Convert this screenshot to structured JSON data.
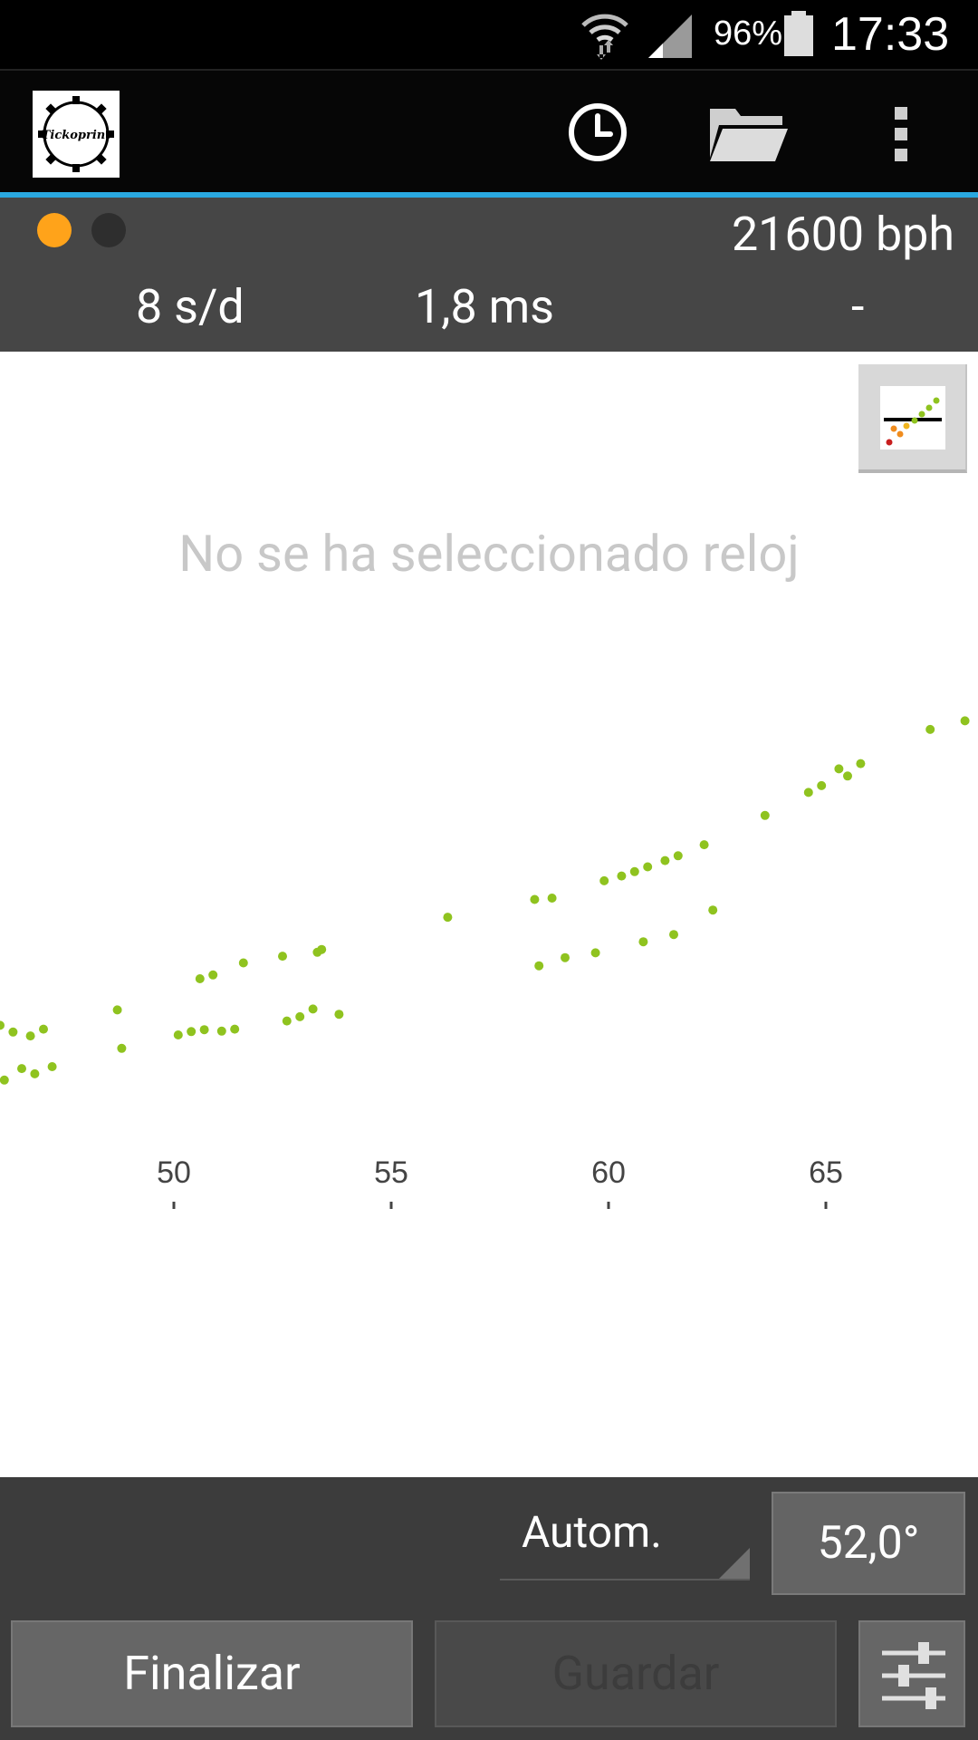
{
  "status_bar": {
    "battery_pct": "96%",
    "time": "17:33",
    "icons": [
      "wifi-icon",
      "signal-icon",
      "battery-icon"
    ]
  },
  "action_bar": {
    "logo_text": "Tickoprint",
    "icons": [
      "clock-icon",
      "folder-icon",
      "overflow-menu-icon"
    ],
    "accent_color": "#2aa8e0"
  },
  "info": {
    "indicator_colors": [
      "#ffa31a",
      "#2e2e2e"
    ],
    "beat_rate": "21600 bph",
    "rate": "8 s/d",
    "amplitude": "1,8 ms",
    "beat_error": "-"
  },
  "chart": {
    "message": "No se ha seleccionado reloj",
    "mode_button_icon": "scatter-chart-icon"
  },
  "chart_data": {
    "type": "scatter",
    "xlabel": "",
    "ylabel": "",
    "x_ticks": [
      "50",
      "55",
      "60",
      "65"
    ],
    "xlim": [
      46.0,
      68.5
    ],
    "ylim": [
      0,
      100
    ],
    "grid": false,
    "point_color": "#8fc31f",
    "series": [
      {
        "x": [
          46.0,
          46.3,
          46.7,
          47.0,
          46.1,
          46.5,
          46.8,
          47.2,
          48.7,
          48.8,
          50.1,
          50.4,
          50.7,
          51.1,
          51.4,
          50.6,
          50.9,
          51.6,
          52.6,
          52.9,
          53.2,
          52.5,
          53.3,
          53.4,
          53.8,
          56.3,
          58.3,
          58.7,
          58.4,
          59.0,
          59.7,
          59.9,
          60.3,
          60.6,
          60.9,
          61.3,
          61.6,
          62.2,
          60.8,
          61.5,
          62.4,
          63.6,
          64.6,
          64.9,
          65.3,
          65.5,
          65.8,
          67.4,
          68.2
        ],
        "y": [
          22.0,
          20.6,
          19.8,
          21.2,
          10.6,
          13.0,
          11.9,
          13.4,
          25.2,
          17.2,
          20.0,
          20.7,
          21.1,
          20.8,
          21.2,
          31.7,
          32.5,
          35.0,
          22.9,
          23.8,
          25.4,
          36.4,
          37.2,
          37.8,
          24.3,
          44.5,
          48.2,
          48.5,
          34.4,
          36.1,
          37.1,
          52.1,
          53.1,
          54.0,
          55.0,
          56.3,
          57.3,
          59.6,
          39.4,
          40.9,
          46.0,
          65.7,
          70.5,
          71.9,
          75.4,
          73.9,
          76.5,
          83.6,
          85.4
        ]
      }
    ]
  },
  "bottom": {
    "mode": "Autom.",
    "angle": "52,0°",
    "finish_label": "Finalizar",
    "save_label": "Guardar",
    "settings_icon": "sliders-icon"
  }
}
